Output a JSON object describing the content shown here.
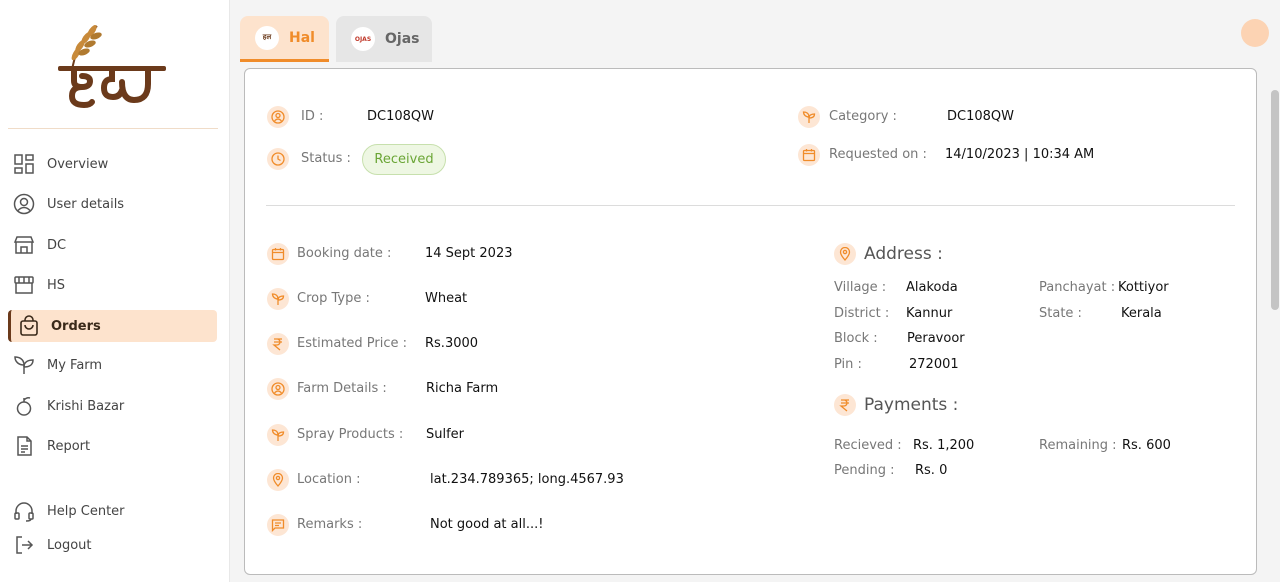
{
  "sidebar": {
    "nav": [
      {
        "label": "Overview",
        "icon": "grid-icon"
      },
      {
        "label": "User details",
        "icon": "user-circle-icon"
      },
      {
        "label": "DC",
        "icon": "store-icon"
      },
      {
        "label": "HS",
        "icon": "shop-icon"
      },
      {
        "label": "Orders",
        "icon": "shopping-bag-icon",
        "active": true
      },
      {
        "label": "My Farm",
        "icon": "sprout-icon"
      },
      {
        "label": "Krishi Bazar",
        "icon": "apple-icon"
      },
      {
        "label": "Report",
        "icon": "document-icon"
      }
    ],
    "bottom": [
      {
        "label": "Help Center",
        "icon": "headphones-icon"
      },
      {
        "label": "Logout",
        "icon": "logout-icon"
      }
    ]
  },
  "tabs": [
    {
      "label": "Hal",
      "badge": "हल",
      "active": true
    },
    {
      "label": "Ojas",
      "badge": "OJAS",
      "active": false
    }
  ],
  "order": {
    "id_label": "ID :",
    "id_value": "DC108QW",
    "status_label": "Status :",
    "status_value": "Received",
    "category_label": "Category :",
    "category_value": "DC108QW",
    "requested_label": "Requested on :",
    "requested_value": "14/10/2023 | 10:34 AM"
  },
  "details": [
    {
      "label": "Booking date :",
      "value": "14 Sept 2023",
      "icon": "calendar-icon"
    },
    {
      "label": "Crop Type :",
      "value": "Wheat",
      "icon": "sprout-icon"
    },
    {
      "label": "Estimated Price :",
      "value": "Rs.3000",
      "icon": "rupee-icon"
    },
    {
      "label": "Farm Details :",
      "value": "Richa Farm",
      "icon": "user-circle-icon"
    },
    {
      "label": "Spray Products :",
      "value": "Sulfer",
      "icon": "sprout-icon"
    },
    {
      "label": "Location :",
      "value": "lat.234.789365; long.4567.93",
      "icon": "location-pin-icon"
    },
    {
      "label": "Remarks :",
      "value": "Not good at all...!",
      "icon": "chat-icon"
    }
  ],
  "address": {
    "title": "Address :",
    "village_label": "Village :",
    "village": "Alakoda",
    "panchayat_label": "Panchayat :",
    "panchayat": "Kottiyor",
    "district_label": "District :",
    "district": "Kannur",
    "state_label": "State :",
    "state": "Kerala",
    "block_label": "Block :",
    "block": "Peravoor",
    "pin_label": "Pin :",
    "pin": "272001"
  },
  "payments": {
    "title": "Payments :",
    "received_label": "Recieved :",
    "received": "Rs. 1,200",
    "remaining_label": "Remaining :",
    "remaining": "Rs. 600",
    "pending_label": "Pending :",
    "pending": "Rs. 0"
  },
  "colors": {
    "accent": "#f08c2a",
    "brand_brown": "#6b3a1b",
    "active_bg": "#fde3cd",
    "status_green": "#6aa535"
  }
}
